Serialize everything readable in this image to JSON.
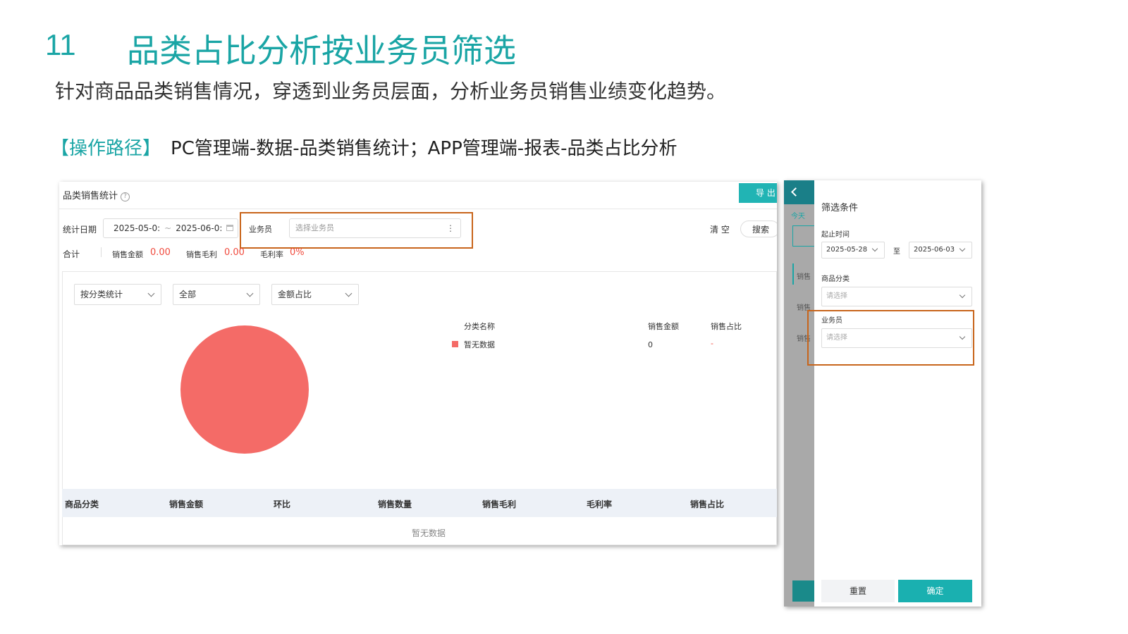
{
  "slide": {
    "number": "11",
    "title": "品类占比分析按业务员筛选",
    "subtitle": "针对商品品类销售情况，穿透到业务员层面，分析业务员销售业绩变化趋势。",
    "path_label": "【操作路径】",
    "path_text": "PC管理端-数据-品类销售统计；APP管理端-报表-品类占比分析"
  },
  "pc": {
    "page_title": "品类销售统计",
    "export_label": "导 出",
    "filters": {
      "date_label": "统计日期",
      "date_start": "2025-05-0:",
      "date_sep": "~",
      "date_end": "2025-06-0:",
      "salesperson_label": "业务员",
      "salesperson_placeholder": "选择业务员",
      "clear_label": "清 空",
      "search_label": "搜索"
    },
    "summary": {
      "total_label": "合计",
      "amount_label": "销售金额",
      "amount_value": "0.00",
      "profit_label": "销售毛利",
      "profit_value": "0.00",
      "margin_label": "毛利率",
      "margin_value": "0%"
    },
    "selects": [
      "按分类统计",
      "全部",
      "金额占比"
    ],
    "legend": {
      "headers": [
        "分类名称",
        "销售金额",
        "销售占比"
      ],
      "rows": [
        {
          "name": "暂无数据",
          "amount": "0",
          "share": "-"
        }
      ]
    },
    "pie_color": "#f46b67",
    "table": {
      "headers": [
        "商品分类",
        "销售金额",
        "环比",
        "销售数量",
        "销售毛利",
        "毛利率",
        "销售占比"
      ],
      "empty_text": "暂无数据"
    }
  },
  "mobile": {
    "bg_today": "今天",
    "bg_items": [
      "销售",
      "销售",
      "销售"
    ],
    "title": "筛选条件",
    "date_label": "起止时间",
    "date_start": "2025-05-28",
    "date_to": "至",
    "date_end": "2025-06-03",
    "category_label": "商品分类",
    "category_placeholder": "请选择",
    "salesperson_label": "业务员",
    "salesperson_placeholder": "请选择",
    "reset_label": "重置",
    "confirm_label": "确定"
  },
  "colors": {
    "accent": "#1aa5a5",
    "highlight": "#c8651b",
    "value_red": "#f04b3e"
  }
}
